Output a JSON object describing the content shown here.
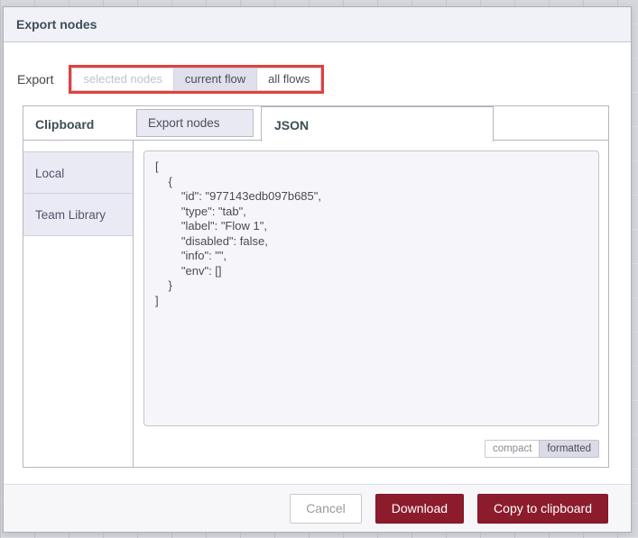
{
  "dialog": {
    "title": "Export nodes"
  },
  "export_row": {
    "label": "Export",
    "options": [
      {
        "label": "selected nodes",
        "state": "disabled"
      },
      {
        "label": "current flow",
        "state": "selected"
      },
      {
        "label": "all flows",
        "state": "normal"
      }
    ],
    "annotation_color": "#e2403d"
  },
  "panel": {
    "sidebar_header": "Clipboard",
    "tabs": [
      {
        "label": "Export nodes",
        "selected": false
      },
      {
        "label": "JSON",
        "selected": true
      }
    ],
    "sidebar_items": [
      {
        "label": "Local"
      },
      {
        "label": "Team Library"
      }
    ],
    "code": "[\n    {\n        \"id\": \"977143edb097b685\",\n        \"type\": \"tab\",\n        \"label\": \"Flow 1\",\n        \"disabled\": false,\n        \"info\": \"\",\n        \"env\": []\n    }\n]",
    "format_buttons": [
      {
        "label": "compact",
        "selected": false
      },
      {
        "label": "formatted",
        "selected": true
      }
    ]
  },
  "footer": {
    "buttons": [
      {
        "label": "Cancel",
        "style": "secondary"
      },
      {
        "label": "Download",
        "style": "primary"
      },
      {
        "label": "Copy to clipboard",
        "style": "primary"
      }
    ]
  },
  "colors": {
    "primary_button": "#8c1c2c",
    "annotation": "#e2403d",
    "header_text": "#3d4e57"
  }
}
